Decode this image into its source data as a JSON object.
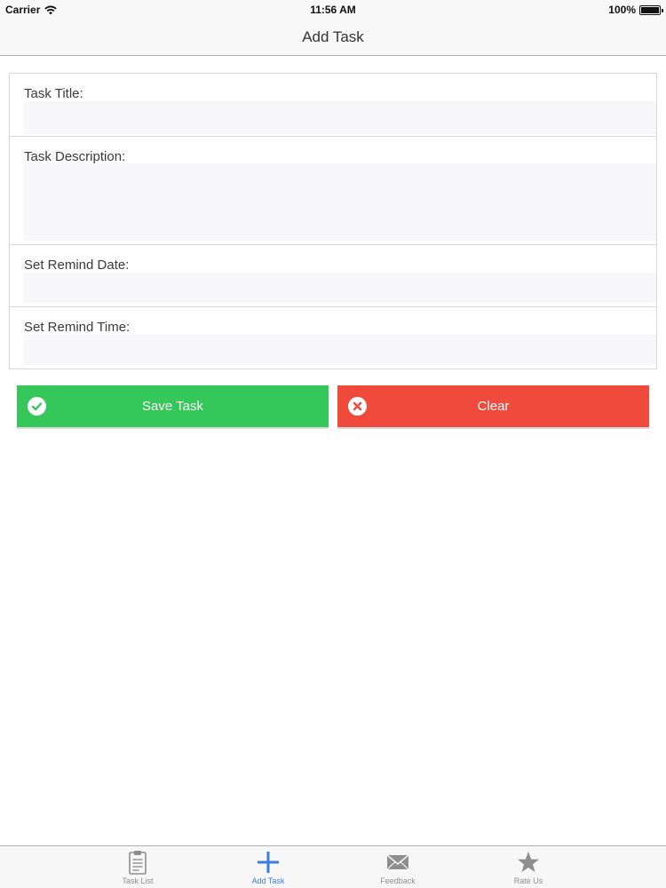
{
  "status_bar": {
    "carrier": "Carrier",
    "time": "11:56 AM",
    "battery": "100%",
    "battery_level": 1.0
  },
  "nav": {
    "title": "Add Task"
  },
  "form": {
    "task_title_label": "Task Title:",
    "task_title_value": "",
    "task_description_label": "Task Description:",
    "task_description_value": "",
    "remind_date_label": "Set Remind Date:",
    "remind_date_value": "",
    "remind_time_label": "Set Remind Time:",
    "remind_time_value": ""
  },
  "actions": {
    "save_label": "Save Task",
    "clear_label": "Clear",
    "save_color": "#35c759",
    "clear_color": "#ef4a3c",
    "save_icon": "checkmark-circle-icon",
    "clear_icon": "x-circle-icon"
  },
  "tab_bar": {
    "items": [
      {
        "label": "Task List",
        "icon": "clipboard-icon",
        "active": false
      },
      {
        "label": "Add Task",
        "icon": "plus-icon",
        "active": true
      },
      {
        "label": "Feedback",
        "icon": "envelope-icon",
        "active": false
      },
      {
        "label": "Rate Us",
        "icon": "star-icon",
        "active": false
      }
    ],
    "active_color": "#3c7ee0",
    "inactive_color": "#8e8e8e"
  }
}
